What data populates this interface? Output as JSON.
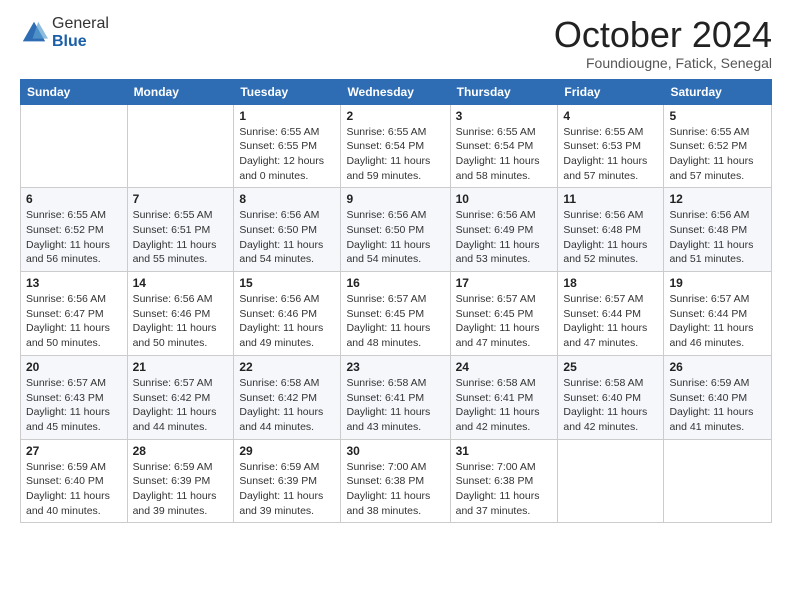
{
  "logo": {
    "general": "General",
    "blue": "Blue"
  },
  "header": {
    "month": "October 2024",
    "location": "Foundiougne, Fatick, Senegal"
  },
  "weekdays": [
    "Sunday",
    "Monday",
    "Tuesday",
    "Wednesday",
    "Thursday",
    "Friday",
    "Saturday"
  ],
  "weeks": [
    [
      {
        "day": "",
        "info": ""
      },
      {
        "day": "",
        "info": ""
      },
      {
        "day": "1",
        "info": "Sunrise: 6:55 AM\nSunset: 6:55 PM\nDaylight: 12 hours\nand 0 minutes."
      },
      {
        "day": "2",
        "info": "Sunrise: 6:55 AM\nSunset: 6:54 PM\nDaylight: 11 hours\nand 59 minutes."
      },
      {
        "day": "3",
        "info": "Sunrise: 6:55 AM\nSunset: 6:54 PM\nDaylight: 11 hours\nand 58 minutes."
      },
      {
        "day": "4",
        "info": "Sunrise: 6:55 AM\nSunset: 6:53 PM\nDaylight: 11 hours\nand 57 minutes."
      },
      {
        "day": "5",
        "info": "Sunrise: 6:55 AM\nSunset: 6:52 PM\nDaylight: 11 hours\nand 57 minutes."
      }
    ],
    [
      {
        "day": "6",
        "info": "Sunrise: 6:55 AM\nSunset: 6:52 PM\nDaylight: 11 hours\nand 56 minutes."
      },
      {
        "day": "7",
        "info": "Sunrise: 6:55 AM\nSunset: 6:51 PM\nDaylight: 11 hours\nand 55 minutes."
      },
      {
        "day": "8",
        "info": "Sunrise: 6:56 AM\nSunset: 6:50 PM\nDaylight: 11 hours\nand 54 minutes."
      },
      {
        "day": "9",
        "info": "Sunrise: 6:56 AM\nSunset: 6:50 PM\nDaylight: 11 hours\nand 54 minutes."
      },
      {
        "day": "10",
        "info": "Sunrise: 6:56 AM\nSunset: 6:49 PM\nDaylight: 11 hours\nand 53 minutes."
      },
      {
        "day": "11",
        "info": "Sunrise: 6:56 AM\nSunset: 6:48 PM\nDaylight: 11 hours\nand 52 minutes."
      },
      {
        "day": "12",
        "info": "Sunrise: 6:56 AM\nSunset: 6:48 PM\nDaylight: 11 hours\nand 51 minutes."
      }
    ],
    [
      {
        "day": "13",
        "info": "Sunrise: 6:56 AM\nSunset: 6:47 PM\nDaylight: 11 hours\nand 50 minutes."
      },
      {
        "day": "14",
        "info": "Sunrise: 6:56 AM\nSunset: 6:46 PM\nDaylight: 11 hours\nand 50 minutes."
      },
      {
        "day": "15",
        "info": "Sunrise: 6:56 AM\nSunset: 6:46 PM\nDaylight: 11 hours\nand 49 minutes."
      },
      {
        "day": "16",
        "info": "Sunrise: 6:57 AM\nSunset: 6:45 PM\nDaylight: 11 hours\nand 48 minutes."
      },
      {
        "day": "17",
        "info": "Sunrise: 6:57 AM\nSunset: 6:45 PM\nDaylight: 11 hours\nand 47 minutes."
      },
      {
        "day": "18",
        "info": "Sunrise: 6:57 AM\nSunset: 6:44 PM\nDaylight: 11 hours\nand 47 minutes."
      },
      {
        "day": "19",
        "info": "Sunrise: 6:57 AM\nSunset: 6:44 PM\nDaylight: 11 hours\nand 46 minutes."
      }
    ],
    [
      {
        "day": "20",
        "info": "Sunrise: 6:57 AM\nSunset: 6:43 PM\nDaylight: 11 hours\nand 45 minutes."
      },
      {
        "day": "21",
        "info": "Sunrise: 6:57 AM\nSunset: 6:42 PM\nDaylight: 11 hours\nand 44 minutes."
      },
      {
        "day": "22",
        "info": "Sunrise: 6:58 AM\nSunset: 6:42 PM\nDaylight: 11 hours\nand 44 minutes."
      },
      {
        "day": "23",
        "info": "Sunrise: 6:58 AM\nSunset: 6:41 PM\nDaylight: 11 hours\nand 43 minutes."
      },
      {
        "day": "24",
        "info": "Sunrise: 6:58 AM\nSunset: 6:41 PM\nDaylight: 11 hours\nand 42 minutes."
      },
      {
        "day": "25",
        "info": "Sunrise: 6:58 AM\nSunset: 6:40 PM\nDaylight: 11 hours\nand 42 minutes."
      },
      {
        "day": "26",
        "info": "Sunrise: 6:59 AM\nSunset: 6:40 PM\nDaylight: 11 hours\nand 41 minutes."
      }
    ],
    [
      {
        "day": "27",
        "info": "Sunrise: 6:59 AM\nSunset: 6:40 PM\nDaylight: 11 hours\nand 40 minutes."
      },
      {
        "day": "28",
        "info": "Sunrise: 6:59 AM\nSunset: 6:39 PM\nDaylight: 11 hours\nand 39 minutes."
      },
      {
        "day": "29",
        "info": "Sunrise: 6:59 AM\nSunset: 6:39 PM\nDaylight: 11 hours\nand 39 minutes."
      },
      {
        "day": "30",
        "info": "Sunrise: 7:00 AM\nSunset: 6:38 PM\nDaylight: 11 hours\nand 38 minutes."
      },
      {
        "day": "31",
        "info": "Sunrise: 7:00 AM\nSunset: 6:38 PM\nDaylight: 11 hours\nand 37 minutes."
      },
      {
        "day": "",
        "info": ""
      },
      {
        "day": "",
        "info": ""
      }
    ]
  ]
}
